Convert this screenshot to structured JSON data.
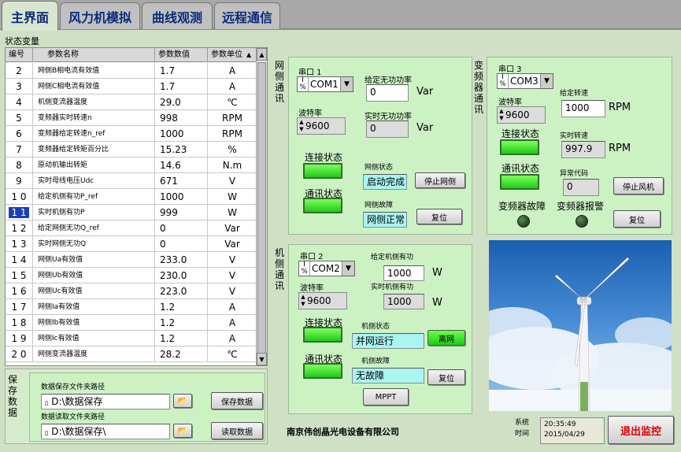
{
  "tabs": [
    "主界面",
    "风力机模拟",
    "曲线观测",
    "远程通信"
  ],
  "state_group_label": "状态变量",
  "table": {
    "headers": [
      "编号",
      "参数名称",
      "参数数值",
      "参数单位"
    ],
    "rows": [
      {
        "idx": "2",
        "name": "网侧B相电流有效值",
        "value": "1.7",
        "unit": "A"
      },
      {
        "idx": "3",
        "name": "网侧C相电流有效值",
        "value": "1.7",
        "unit": "A"
      },
      {
        "idx": "4",
        "name": "机侧变流器温度",
        "value": "29.0",
        "unit": "℃"
      },
      {
        "idx": "5",
        "name": "变频器实时转速n",
        "value": "998",
        "unit": "RPM"
      },
      {
        "idx": "6",
        "name": "变频器给定转速n_ref",
        "value": "1000",
        "unit": "RPM"
      },
      {
        "idx": "7",
        "name": "变频器给定转矩百分比",
        "value": "15.23",
        "unit": "%"
      },
      {
        "idx": "8",
        "name": "原动机输出转矩",
        "value": "14.6",
        "unit": "N.m"
      },
      {
        "idx": "9",
        "name": "实时母线电压Udc",
        "value": "671",
        "unit": "V"
      },
      {
        "idx": "1 0",
        "name": "给定机侧有功P_ref",
        "value": "1000",
        "unit": "W"
      },
      {
        "idx": "1 1",
        "name": "实时机侧有功P",
        "value": "999",
        "unit": "W"
      },
      {
        "idx": "1 2",
        "name": "给定网侧无功Q_ref",
        "value": "0",
        "unit": "Var"
      },
      {
        "idx": "1 3",
        "name": "实时网侧无功Q",
        "value": "0",
        "unit": "Var"
      },
      {
        "idx": "1 4",
        "name": "网侧Ua有效值",
        "value": "233.0",
        "unit": "V"
      },
      {
        "idx": "1 5",
        "name": "网侧Ub有效值",
        "value": "230.0",
        "unit": "V"
      },
      {
        "idx": "1 6",
        "name": "网侧Uc有效值",
        "value": "223.0",
        "unit": "V"
      },
      {
        "idx": "1 7",
        "name": "网侧Ia有效值",
        "value": "1.2",
        "unit": "A"
      },
      {
        "idx": "1 8",
        "name": "网侧Ib有效值",
        "value": "1.2",
        "unit": "A"
      },
      {
        "idx": "1 9",
        "name": "网侧Ic有效值",
        "value": "1.2",
        "unit": "A"
      },
      {
        "idx": "2 0",
        "name": "网侧变流器温度",
        "value": "28.2",
        "unit": "℃"
      }
    ],
    "selected_idx": "1 1"
  },
  "save": {
    "group_label": "保存数据",
    "save_path_label": "数据保存文件夹路径",
    "save_path": "D:\\数据保存",
    "read_path_label": "数据读取文件夹路径",
    "read_path": "D:\\数据保存\\",
    "save_button": "保存数据",
    "read_button": "读取数据"
  },
  "grid_comm": {
    "title": "网侧通讯",
    "port_label": "串口 1",
    "port": "COM1",
    "baud_label": "波特率",
    "baud": "9600",
    "q_set_label": "给定无功功率",
    "q_set": "0",
    "q_set_unit": "Var",
    "q_act_label": "实时无功功率",
    "q_act": "0",
    "q_act_unit": "Var",
    "conn_label": "连接状态",
    "comm_label": "通讯状态",
    "state_label": "网侧状态",
    "state": "启动完成",
    "stop_button": "停止网侧",
    "fault_label": "网侧故障",
    "fault": "网侧正常",
    "reset_button": "复位"
  },
  "vfd_comm": {
    "title": "变频器通讯",
    "port_label": "串口 3",
    "port": "COM3",
    "baud_label": "波特率",
    "baud": "9600",
    "speed_set_label": "给定转速",
    "speed_set": "1000",
    "speed_set_unit": "RPM",
    "speed_act_label": "实时转速",
    "speed_act": "997.9",
    "speed_act_unit": "RPM",
    "conn_label": "连接状态",
    "comm_label": "通讯状态",
    "err_label": "异常代码",
    "err": "0",
    "stop_button": "停止风机",
    "fault_label": "变频器故障",
    "alarm_label": "变频器报警",
    "reset_button": "复位"
  },
  "machine_comm": {
    "title": "机侧通讯",
    "port_label": "串口 2",
    "port": "COM2",
    "baud_label": "波特率",
    "baud": "9600",
    "p_set_label": "给定机侧有功",
    "p_set": "1000",
    "p_set_unit": "W",
    "p_act_label": "实时机侧有功",
    "p_act": "1000",
    "p_act_unit": "W",
    "conn_label": "连接状态",
    "comm_label": "通讯状态",
    "state_label": "机侧状态",
    "state": "并网运行",
    "offgrid_button": "离网",
    "fault_label": "机侧故障",
    "fault": "无故障",
    "reset_button": "复位",
    "mppt_button": "MPPT"
  },
  "footer": {
    "company": "南京伟创晶光电设备有限公司",
    "time_label": "系统时间",
    "time": "20:35:49",
    "date": "2015/04/29",
    "exit_button": "退出监控"
  },
  "colors": {
    "accent_tab_text": "#0a2a7a",
    "panel_bg": "#ccf2c4",
    "led_on": "#3ee02a",
    "exit_text": "#e00000"
  }
}
